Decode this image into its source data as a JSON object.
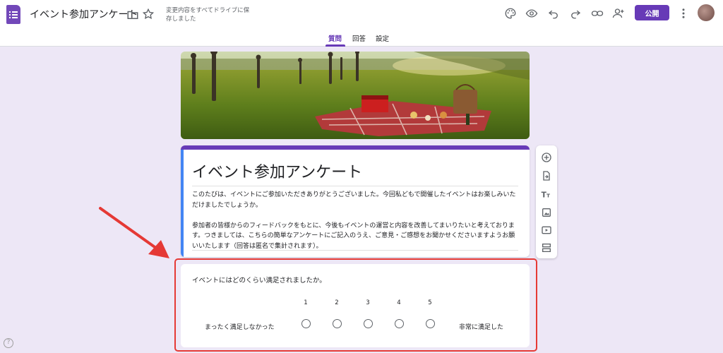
{
  "header": {
    "title": "イベント参加アンケート",
    "save_status": "変更内容をすべてドライブに保存しました",
    "publish_label": "公開",
    "tabs": [
      {
        "label": "質問",
        "active": true
      },
      {
        "label": "回答",
        "active": false
      },
      {
        "label": "設定",
        "active": false
      }
    ],
    "icons": [
      "folder-icon",
      "star-icon",
      "palette-icon",
      "preview-icon",
      "undo-icon",
      "redo-icon",
      "link-icon",
      "add-collaborator-icon",
      "more-vert-icon"
    ]
  },
  "form": {
    "title": "イベント参加アンケート",
    "description_p1": "このたびは、イベントにご参加いただきありがとうございました。今回私どもで開催したイベントはお楽しみいただけましたでしょうか。",
    "description_p2": "参加者の皆様からのフィードバックをもとに、今後もイベントの運営と内容を改善してまいりたいと考えております。つきましては、こちらの簡単なアンケートにご記入のうえ、ご意見・ご感想をお聞かせくださいますようお願いいたします（回答は匿名で集計されます）。"
  },
  "question": {
    "text": "イベントにはどのくらい満足されましたか。",
    "scale": [
      "1",
      "2",
      "3",
      "4",
      "5"
    ],
    "low_label": "まったく満足しなかった",
    "high_label": "非常に満足した"
  },
  "side_toolbar": [
    "add-question-icon",
    "import-questions-icon",
    "add-title-icon",
    "add-image-icon",
    "add-video-icon",
    "add-section-icon"
  ],
  "help": {
    "label": "?"
  },
  "colors": {
    "accent": "#673ab7",
    "background": "#ede7f6",
    "focus_stripe": "#4285f4",
    "annotation": "#e53935"
  }
}
